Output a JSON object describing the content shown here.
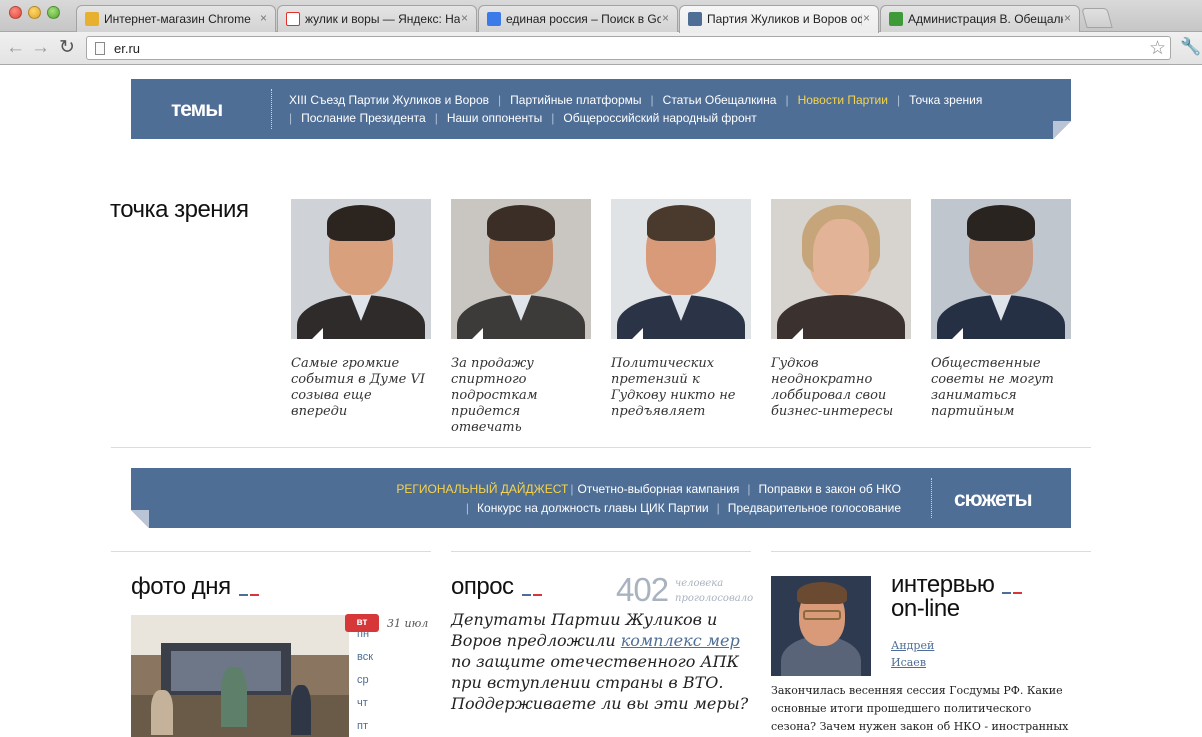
{
  "browser": {
    "tabs": [
      {
        "title": "Интернет-магазин Chrome",
        "favicon_color": "#e8b02f"
      },
      {
        "title": "жулик и воры — Яндекс: На",
        "favicon_color": "#e0322b"
      },
      {
        "title": "единая россия – Поиск в Go",
        "favicon_color": "#3b7be9"
      },
      {
        "title": "Партия Жуликов и Воров оф",
        "favicon_color": "#4f6e96"
      },
      {
        "title": "Администрация В. Обещалк",
        "favicon_color": "#3f9a3a"
      }
    ],
    "close_glyph": "×",
    "back_glyph": "←",
    "forward_glyph": "→",
    "reload_glyph": "↻",
    "url": "er.ru",
    "star_glyph": "☆",
    "wrench_glyph": "🔧"
  },
  "topics": {
    "logo": "темы",
    "links": [
      "XIII Съезд Партии Жуликов и Воров",
      "Партийные платформы",
      "Статьи Обещалкина",
      "Новости Партии",
      "Точка зрения",
      "Послание Президента",
      "Наши оппоненты",
      "Общероссийский народный фронт"
    ],
    "highlight_index": 3,
    "separator": "|"
  },
  "point_of_view": {
    "heading": "точка зрения",
    "cards": [
      {
        "caption": "Самые громкие события в Думе VI созыва еще впереди",
        "bg": "#cfd3d8",
        "skin": "#d9a07e",
        "hair": "#2b241f",
        "clothes": "#2e2b2a"
      },
      {
        "caption": "За продажу спиртного подросткам придется отвечать",
        "bg": "#c9c6c2",
        "skin": "#c58e6c",
        "hair": "#3a2e26",
        "clothes": "#3d3b3a"
      },
      {
        "caption": "Политических претензий к Гудкову никто не предъявляет",
        "bg": "#dfe3e6",
        "skin": "#d99a7a",
        "hair": "#4a3a2e",
        "clothes": "#2a3446"
      },
      {
        "caption": "Гудков неоднократно лоббировал свои бизнес-интересы",
        "bg": "#d7d4cf",
        "skin": "#e2b397",
        "hair": "#c7a57b",
        "clothes": "#3b3230"
      },
      {
        "caption": "Общественные советы не могут заниматься партийным",
        "bg": "#bfc6cd",
        "skin": "#c99a82",
        "hair": "#2a2420",
        "clothes": "#263044"
      }
    ]
  },
  "stories": {
    "logo": "сюжеты",
    "highlight": "РЕГИОНАЛЬНЫЙ ДАЙДЖЕСТ",
    "links_row1": [
      "Отчетно-выборная кампания",
      "Поправки в закон об НКО"
    ],
    "links_row2": [
      "Конкурс на должность главы ЦИК Партии",
      "Предварительное голосование"
    ],
    "separator": "|"
  },
  "photo_day": {
    "heading": "фото дня",
    "active_day": "вт",
    "days": [
      "пн",
      "вск",
      "ср",
      "чт",
      "пт"
    ],
    "date": "31 июл"
  },
  "poll": {
    "heading": "опрос",
    "count": "402",
    "count_label_1": "человека",
    "count_label_2": "проголосовало",
    "question_before": "Депутаты Партии Жуликов и Воров предложили ",
    "question_link": "комплекс мер",
    "question_after": " по защите отечественного АПК при вступлении страны в ВТО. Поддерживаете ли вы эти меры?"
  },
  "interview": {
    "heading_1": "интервью",
    "heading_2": "on-line",
    "first_name": "Андрей",
    "last_name": "Исаев",
    "text": "Закончилась весенняя сессия Госдумы РФ. Какие основные итоги прошедшего политического сезона? Зачем нужен закон об НКО - иностранных агентах и"
  },
  "colors": {
    "brand_blue": "#4f6e96",
    "highlight_yellow": "#f7d44a",
    "flag_blue": "#4f6e96",
    "flag_red": "#d6383a"
  }
}
